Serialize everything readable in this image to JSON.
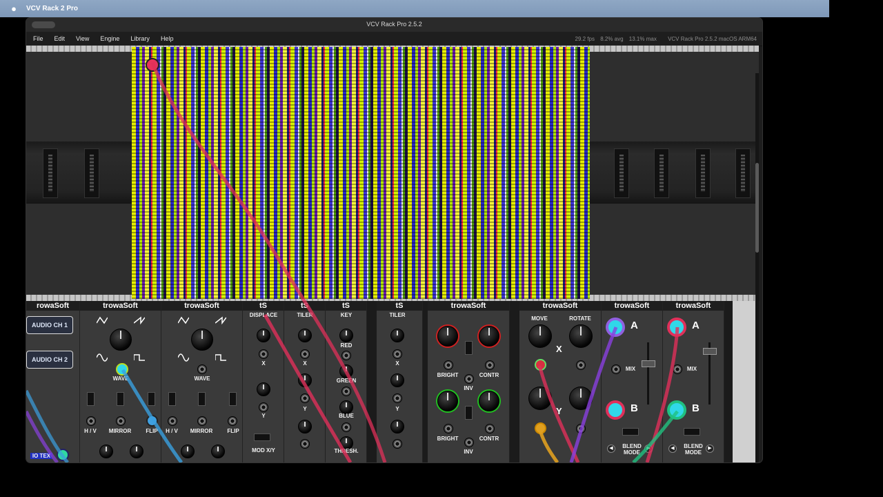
{
  "os_menubar": {
    "app_name": "VCV Rack 2 Pro"
  },
  "window": {
    "title": "VCV Rack Pro 2.5.2",
    "menus": [
      "File",
      "Edit",
      "View",
      "Engine",
      "Library",
      "Help"
    ],
    "stats": {
      "fps": "29.2 fps",
      "avg": "8.2% avg",
      "max": "13.1% max",
      "version": "VCV Rack Pro 2.5.2 macOS ARM64"
    }
  },
  "modules": {
    "audio": {
      "brand": "rowaSoft",
      "ch1": "AUDIO CH 1",
      "ch2": "AUDIO CH 2",
      "bottom": "IO TEX"
    },
    "osc1": {
      "brand": "trowaSoft",
      "wave": "WAVE",
      "hv": "H / V",
      "mirror": "MIRROR",
      "flip": "FLIP"
    },
    "osc2": {
      "brand": "trowaSoft",
      "wave": "WAVE",
      "hv": "H / V",
      "mirror": "MIRROR",
      "flip": "FLIP"
    },
    "displace": {
      "brand": "tS",
      "title": "DISPLACE",
      "x": "X",
      "y": "Y",
      "modxy": "MOD X/Y"
    },
    "tiler1": {
      "brand": "tS",
      "title": "TILER",
      "x": "X",
      "y": "Y"
    },
    "key": {
      "brand": "tS",
      "title": "KEY",
      "red": "RED",
      "green": "GREEN",
      "blue": "BLUE",
      "thresh": "THRESH."
    },
    "tiler2": {
      "brand": "tS",
      "title": "TILER",
      "x": "X",
      "y": "Y"
    },
    "color": {
      "brand": "trowaSoft",
      "bright1": "BRIGHT",
      "contr1": "CONTR",
      "inv1": "INV",
      "bright2": "BRIGHT",
      "contr2": "CONTR",
      "inv2": "INV"
    },
    "transform": {
      "brand": "trowaSoft",
      "move": "MOVE",
      "rotate": "ROTATE",
      "x": "X",
      "y": "Y"
    },
    "blend1": {
      "brand": "trowaSoft",
      "a": "A",
      "b": "B",
      "mix": "MIX",
      "mode": "BLEND\nMODE"
    },
    "blend2": {
      "brand": "trowaSoft",
      "a": "A",
      "b": "B",
      "mix": "MIX",
      "mode": "BLEND\nMODE"
    }
  },
  "colors": {
    "cable_red": "#e0305a",
    "cable_purple": "#8a40e0",
    "cable_blue": "#3aa0e0",
    "cable_green": "#20c080",
    "jack_cyan": "#30d8e8"
  }
}
